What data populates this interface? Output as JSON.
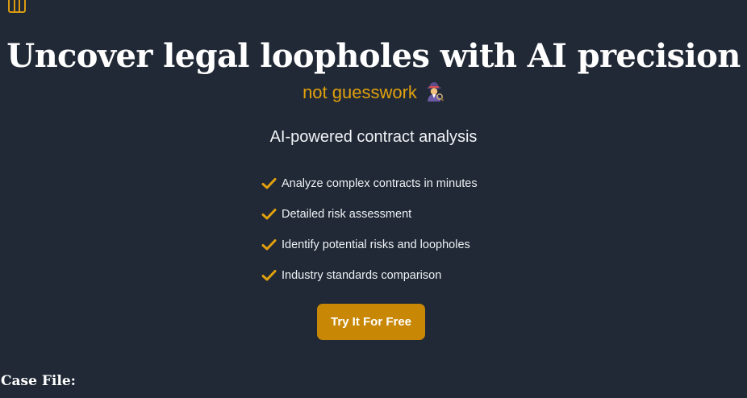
{
  "theme": {
    "background": "#212936",
    "accent": "#e2a10d",
    "button": "#c88806"
  },
  "header": {
    "menu_icon": "columns-icon"
  },
  "hero": {
    "title": "Uncover legal loopholes with AI precision",
    "subtitle": "not guesswork",
    "subtitle_icon": "detective-emoji-icon",
    "tagline": "AI-powered contract analysis"
  },
  "features": {
    "icon": "check-icon",
    "items": [
      {
        "label": "Analyze complex contracts in minutes"
      },
      {
        "label": "Detailed risk assessment"
      },
      {
        "label": "Identify potential risks and loopholes"
      },
      {
        "label": "Industry standards comparison"
      }
    ]
  },
  "cta": {
    "label": "Try It For Free"
  },
  "case_file": {
    "heading": "Case File:"
  }
}
